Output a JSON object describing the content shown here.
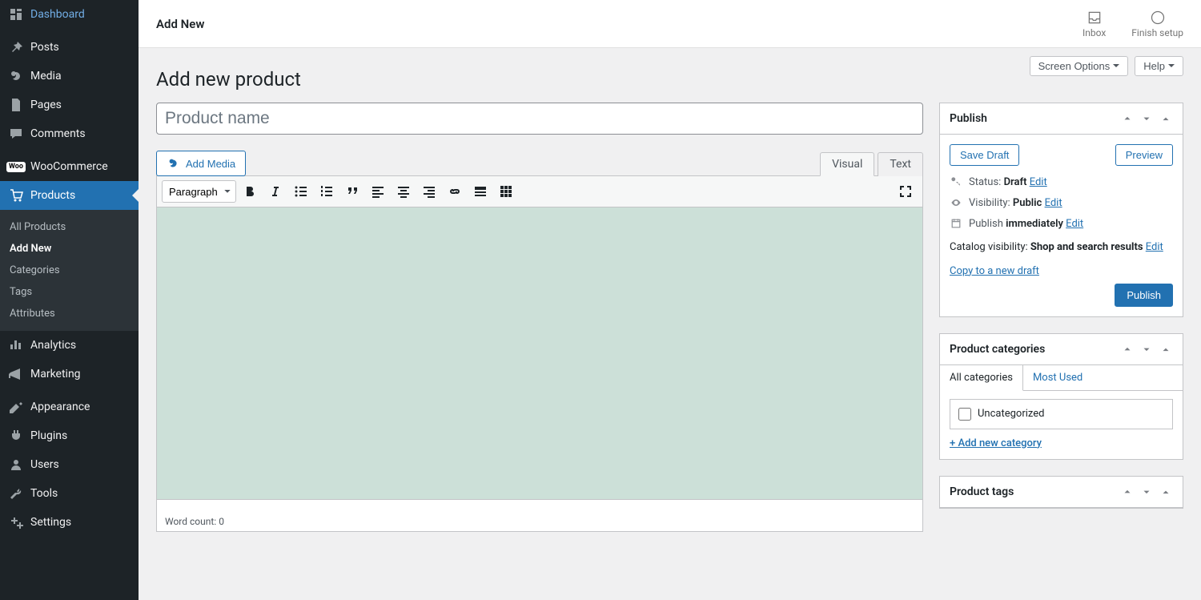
{
  "sidebar": {
    "items": [
      {
        "label": "Dashboard",
        "icon": "dashboard"
      },
      {
        "label": "Posts",
        "icon": "pin"
      },
      {
        "label": "Media",
        "icon": "media"
      },
      {
        "label": "Pages",
        "icon": "pages"
      },
      {
        "label": "Comments",
        "icon": "comments"
      },
      {
        "label": "WooCommerce",
        "icon": "woo"
      },
      {
        "label": "Products",
        "icon": "products",
        "active": true
      },
      {
        "label": "Analytics",
        "icon": "analytics"
      },
      {
        "label": "Marketing",
        "icon": "marketing"
      },
      {
        "label": "Appearance",
        "icon": "appearance"
      },
      {
        "label": "Plugins",
        "icon": "plugins"
      },
      {
        "label": "Users",
        "icon": "users"
      },
      {
        "label": "Tools",
        "icon": "tools"
      },
      {
        "label": "Settings",
        "icon": "settings"
      }
    ],
    "submenu": {
      "items": [
        "All Products",
        "Add New",
        "Categories",
        "Tags",
        "Attributes"
      ],
      "current": "Add New"
    }
  },
  "topbar": {
    "title": "Add New",
    "inbox": "Inbox",
    "finish_setup": "Finish setup"
  },
  "utils": {
    "screen_options": "Screen Options",
    "help": "Help"
  },
  "page": {
    "heading": "Add new product",
    "title_placeholder": "Product name"
  },
  "editor": {
    "add_media": "Add Media",
    "tabs": {
      "visual": "Visual",
      "text": "Text"
    },
    "format_select": "Paragraph",
    "word_count_label": "Word count:",
    "word_count_value": "0"
  },
  "publish_box": {
    "title": "Publish",
    "save_draft": "Save Draft",
    "preview": "Preview",
    "status_label": "Status:",
    "status_value": "Draft",
    "visibility_label": "Visibility:",
    "visibility_value": "Public",
    "publish_label": "Publish",
    "publish_value": "immediately",
    "catalog_label": "Catalog visibility:",
    "catalog_value": "Shop and search results",
    "edit": "Edit",
    "copy_link": "Copy to a new draft",
    "publish_btn": "Publish"
  },
  "categories_box": {
    "title": "Product categories",
    "tab_all": "All categories",
    "tab_most": "Most Used",
    "uncategorized": "Uncategorized",
    "add_new": "+ Add new category"
  },
  "tags_box": {
    "title": "Product tags"
  }
}
